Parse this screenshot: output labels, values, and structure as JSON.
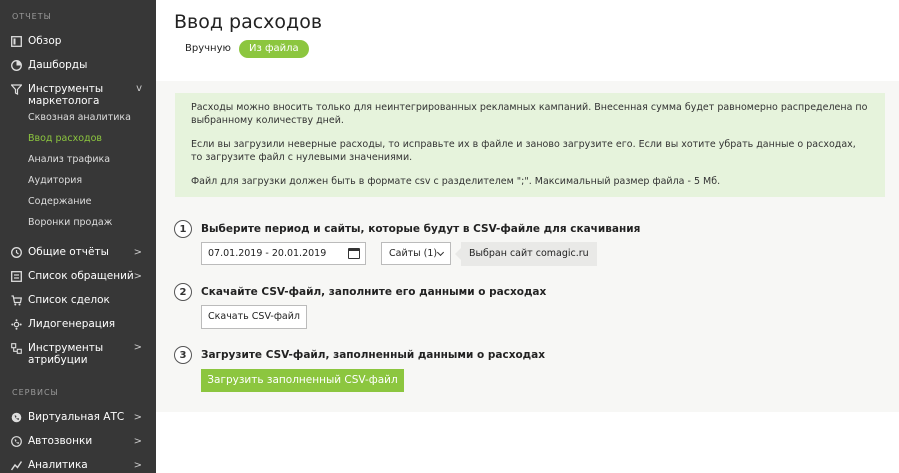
{
  "sidebar": {
    "section_reports": "ОТЧЕТЫ",
    "section_services": "СЕРВИСЫ",
    "items": [
      {
        "label": "Обзор",
        "icon": "overview-icon"
      },
      {
        "label": "Дашборды",
        "icon": "dashboard-icon"
      },
      {
        "label": "Инструменты маркетолога",
        "icon": "filter-icon",
        "arrow": "v"
      },
      {
        "label": "Общие отчёты",
        "icon": "reports-icon",
        "arrow": ">"
      },
      {
        "label": "Список обращений",
        "icon": "list-icon",
        "arrow": ">"
      },
      {
        "label": "Список сделок",
        "icon": "cart-icon"
      },
      {
        "label": "Лидогенерация",
        "icon": "leadgen-icon"
      },
      {
        "label": "Инструменты атрибуции",
        "icon": "attribution-icon",
        "arrow": ">"
      },
      {
        "label": "Виртуальная АТС",
        "icon": "pbx-icon",
        "arrow": ">"
      },
      {
        "label": "Автозвонки",
        "icon": "autocall-icon",
        "arrow": ">"
      },
      {
        "label": "Аналитика",
        "icon": "analytics-icon",
        "arrow": ">"
      }
    ],
    "subitems": [
      {
        "label": "Сквозная аналитика"
      },
      {
        "label": "Ввод расходов"
      },
      {
        "label": "Анализ трафика"
      },
      {
        "label": "Аудитория"
      },
      {
        "label": "Содержание"
      },
      {
        "label": "Воронки продаж"
      }
    ]
  },
  "main": {
    "title": "Ввод расходов",
    "tabs": {
      "manual": "Вручную",
      "file": "Из файла"
    },
    "info": [
      "Расходы можно вносить только для неинтегрированных рекламных кампаний. Внесенная сумма будет равномерно распределена по выбранному количеству дней.",
      "Если вы загрузили неверные расходы, то исправьте их в файле и заново загрузите его. Если вы хотите убрать данные о расходах, то загрузите файл с нулевыми значениями.",
      "Файл для загрузки должен быть в формате csv с разделителем \";\". Максимальный размер файла - 5 Мб."
    ],
    "steps": [
      {
        "num": "1",
        "title": "Выберите период и сайты, которые будут в CSV-файле для скачивания"
      },
      {
        "num": "2",
        "title": "Скачайте CSV-файл, заполните его данными о расходах"
      },
      {
        "num": "3",
        "title": "Загрузите CSV-файл, заполненный данными о расходах"
      }
    ],
    "date_range": "07.01.2019 - 20.01.2019",
    "sites_select": "Сайты (1)",
    "sites_tooltip": "Выбран сайт comagic.ru",
    "download_button": "Скачать CSV-файл",
    "upload_button": "Загрузить заполненный CSV-файл"
  },
  "colors": {
    "accent": "#8cc63f",
    "sidebar_bg": "#373737",
    "info_bg": "#e6f3dc"
  }
}
